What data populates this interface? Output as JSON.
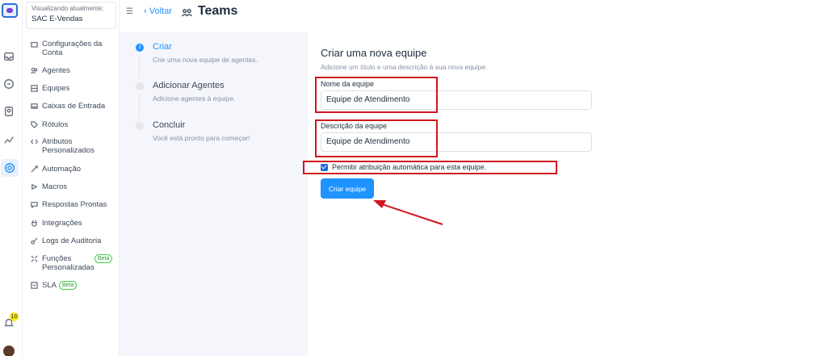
{
  "account": {
    "label": "Visualizando atualmente:",
    "name": "SAC E-Vendas"
  },
  "rail": {
    "notification_count": "10"
  },
  "sidebar": {
    "items": [
      {
        "label": "Configurações da Conta",
        "icon": "building-icon"
      },
      {
        "label": "Agentes",
        "icon": "people-icon"
      },
      {
        "label": "Equipes",
        "icon": "team-icon"
      },
      {
        "label": "Caixas de Entrada",
        "icon": "inbox-icon"
      },
      {
        "label": "Rótulos",
        "icon": "tag-icon"
      },
      {
        "label": "Atributos Personalizados",
        "icon": "code-icon"
      },
      {
        "label": "Automação",
        "icon": "automation-icon"
      },
      {
        "label": "Macros",
        "icon": "macro-icon"
      },
      {
        "label": "Respostas Prontas",
        "icon": "chat-icon"
      },
      {
        "label": "Integrações",
        "icon": "plug-icon"
      },
      {
        "label": "Logs de Auditoria",
        "icon": "key-icon"
      },
      {
        "label": "Funções Personalizadas",
        "icon": "roles-icon",
        "badge": "Beta"
      },
      {
        "label": "SLA",
        "icon": "sla-icon",
        "badge": "Beta"
      }
    ]
  },
  "header": {
    "back_label": "Voltar",
    "title": "Teams"
  },
  "wizard": {
    "steps": [
      {
        "title": "Criar",
        "desc": "Crie uma nova equipe de agentes.",
        "active": true
      },
      {
        "title": "Adicionar Agentes",
        "desc": "Adicione agentes à equipe.",
        "active": false
      },
      {
        "title": "Concluir",
        "desc": "Você está pronto para começar!",
        "active": false
      }
    ]
  },
  "form": {
    "title": "Criar uma nova equipe",
    "subtitle": "Adicione um título e uma descrição à sua nova equipe.",
    "name_label": "Nome da equipe",
    "name_value": "Equipe de Atendimento",
    "desc_label": "Descrição da equipe",
    "desc_value": "Equipe de Atendimento",
    "auto_assign_label": "Permitir atribuição automática para esta equipe.",
    "auto_assign_checked": true,
    "submit_label": "Criar equipe"
  },
  "colors": {
    "accent": "#1f93ff",
    "annotation": "#d0161f",
    "beta": "#44ce4b"
  }
}
